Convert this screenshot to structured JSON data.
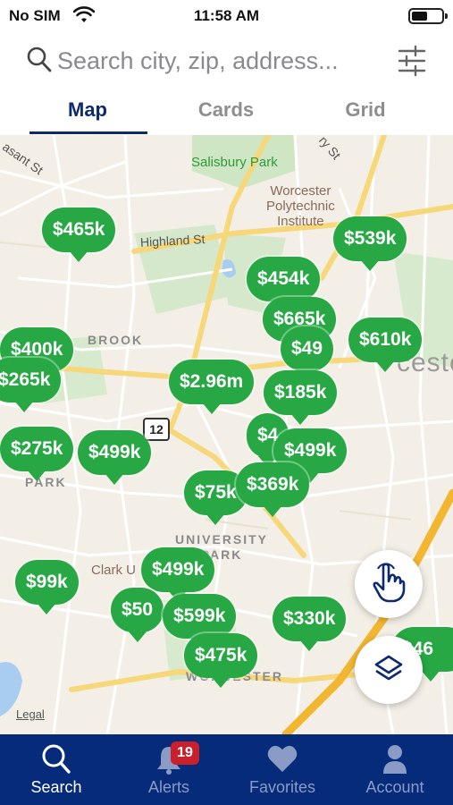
{
  "status_bar": {
    "carrier": "No SIM",
    "time": "11:58 AM"
  },
  "search": {
    "placeholder": "Search city, zip, address..."
  },
  "tabs": [
    {
      "label": "Map"
    },
    {
      "label": "Cards"
    },
    {
      "label": "Grid"
    }
  ],
  "map": {
    "labels": {
      "salisbury_park": "Salisbury Park",
      "wpi": "Worcester\nPolytechnic\nInstitute",
      "highland_st": "Highland St",
      "brook": "BROOK",
      "park": "PARK",
      "university_park": "UNIVERSITY\nPARK",
      "clark": "Clark U",
      "worcester": "ceste",
      "worcester_bottom": "WORCESTER",
      "pleasant_st": "asant St",
      "rd": "ry St",
      "route": "12",
      "legal": "Legal"
    },
    "pins": [
      "$465k",
      "$539k",
      "$454k",
      "$665k",
      "$49",
      "$610k",
      "$400k",
      "$265k",
      "$2.96m",
      "$185k",
      "$4",
      "$499k",
      "$275k",
      "$499k",
      "$75k",
      "$369k",
      "$99k",
      "$499k",
      "$50",
      "$599k",
      "$330k",
      "$475k",
      "$46"
    ]
  },
  "bottom_nav": [
    {
      "label": "Search"
    },
    {
      "label": "Alerts",
      "badge": "19"
    },
    {
      "label": "Favorites"
    },
    {
      "label": "Account"
    }
  ],
  "colors": {
    "accent": "#0d2a6e",
    "nav_bg": "#062b7a",
    "pin": "#27a844",
    "badge": "#c9202b"
  }
}
